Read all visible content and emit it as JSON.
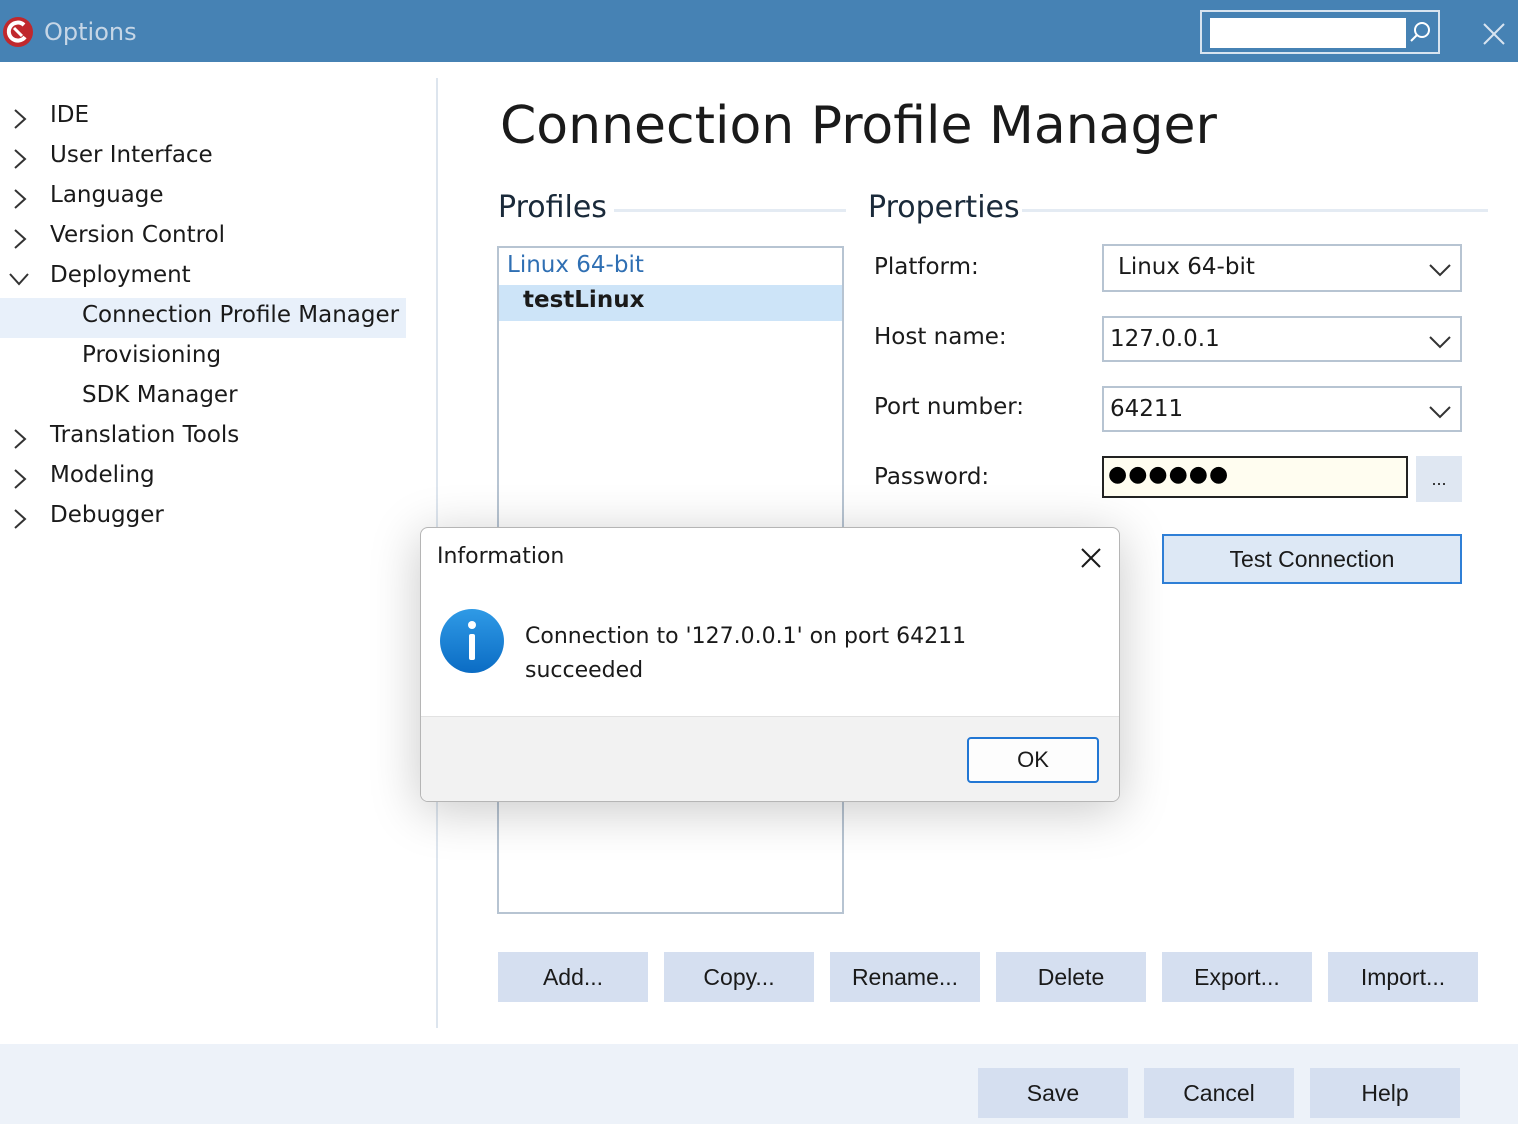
{
  "window": {
    "title": "Options",
    "search_value": ""
  },
  "tree": {
    "ide": "IDE",
    "user_interface": "User Interface",
    "language": "Language",
    "version_control": "Version Control",
    "deployment": "Deployment",
    "connection_profile_manager": "Connection Profile Manager",
    "provisioning": "Provisioning",
    "sdk_manager": "SDK Manager",
    "translation_tools": "Translation Tools",
    "modeling": "Modeling",
    "debugger": "Debugger"
  },
  "page": {
    "title": "Connection Profile Manager"
  },
  "profiles": {
    "heading": "Profiles",
    "group": "Linux 64-bit",
    "selected_item": "testLinux"
  },
  "properties": {
    "heading": "Properties",
    "platform_label": "Platform:",
    "platform_value": "Linux 64-bit",
    "host_label": "Host name:",
    "host_value": "127.0.0.1",
    "port_label": "Port number:",
    "port_value": "64211",
    "password_label": "Password:",
    "password_value": "●●●●●●",
    "browse_label": "...",
    "test_label": "Test Connection"
  },
  "profile_buttons": {
    "add": "Add...",
    "copy": "Copy...",
    "rename": "Rename...",
    "delete": "Delete",
    "export": "Export...",
    "import": "Import..."
  },
  "footer": {
    "save": "Save",
    "cancel": "Cancel",
    "help": "Help"
  },
  "dialog": {
    "title": "Information",
    "message": "Connection to '127.0.0.1' on port 64211 succeeded",
    "ok": "OK"
  },
  "colors": {
    "titlebar": "#4682b4",
    "selection": "#cde4f8",
    "button": "#d5dff0",
    "accent": "#2277d4"
  },
  "icons": [
    "app-icon",
    "search-icon",
    "close-icon",
    "chevron-right-icon",
    "chevron-down-icon",
    "info-icon"
  ]
}
